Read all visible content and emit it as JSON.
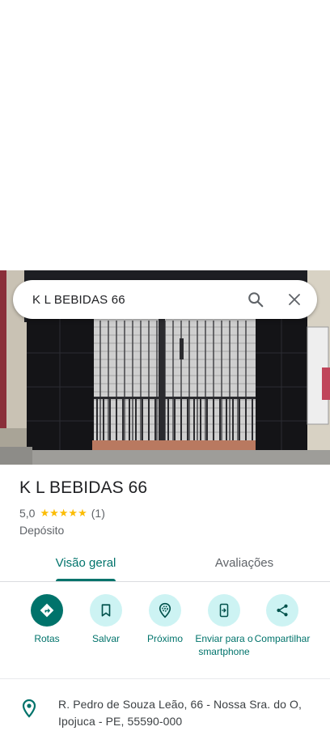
{
  "search": {
    "query": "K L BEBIDAS 66",
    "search_icon": "search-icon",
    "close_icon": "close-icon"
  },
  "photo": {
    "subject": "storefront-photo"
  },
  "place": {
    "name": "K L BEBIDAS 66",
    "rating": "5,0",
    "stars": "★★★★★",
    "review_count": "(1)",
    "category": "Depósito"
  },
  "tabs": [
    {
      "label": "Visão geral",
      "active": true
    },
    {
      "label": "Avaliações",
      "active": false
    }
  ],
  "actions": [
    {
      "label": "Rotas",
      "icon": "directions-icon"
    },
    {
      "label": "Salvar",
      "icon": "bookmark-icon"
    },
    {
      "label": "Próximo",
      "icon": "nearby-icon"
    },
    {
      "label": "Enviar para o smartphone",
      "icon": "send-to-phone-icon"
    },
    {
      "label": "Compartilhar",
      "icon": "share-icon"
    }
  ],
  "address": {
    "text": "R. Pedro de Souza Leão, 66 - Nossa Sra. do O, Ipojuca - PE, 55590-000",
    "icon": "location-pin-icon"
  },
  "colors": {
    "accent": "#00736b",
    "accent_light": "#cdf3f3",
    "star": "#fbbc04",
    "text_primary": "#202124",
    "text_secondary": "#5f6368"
  }
}
